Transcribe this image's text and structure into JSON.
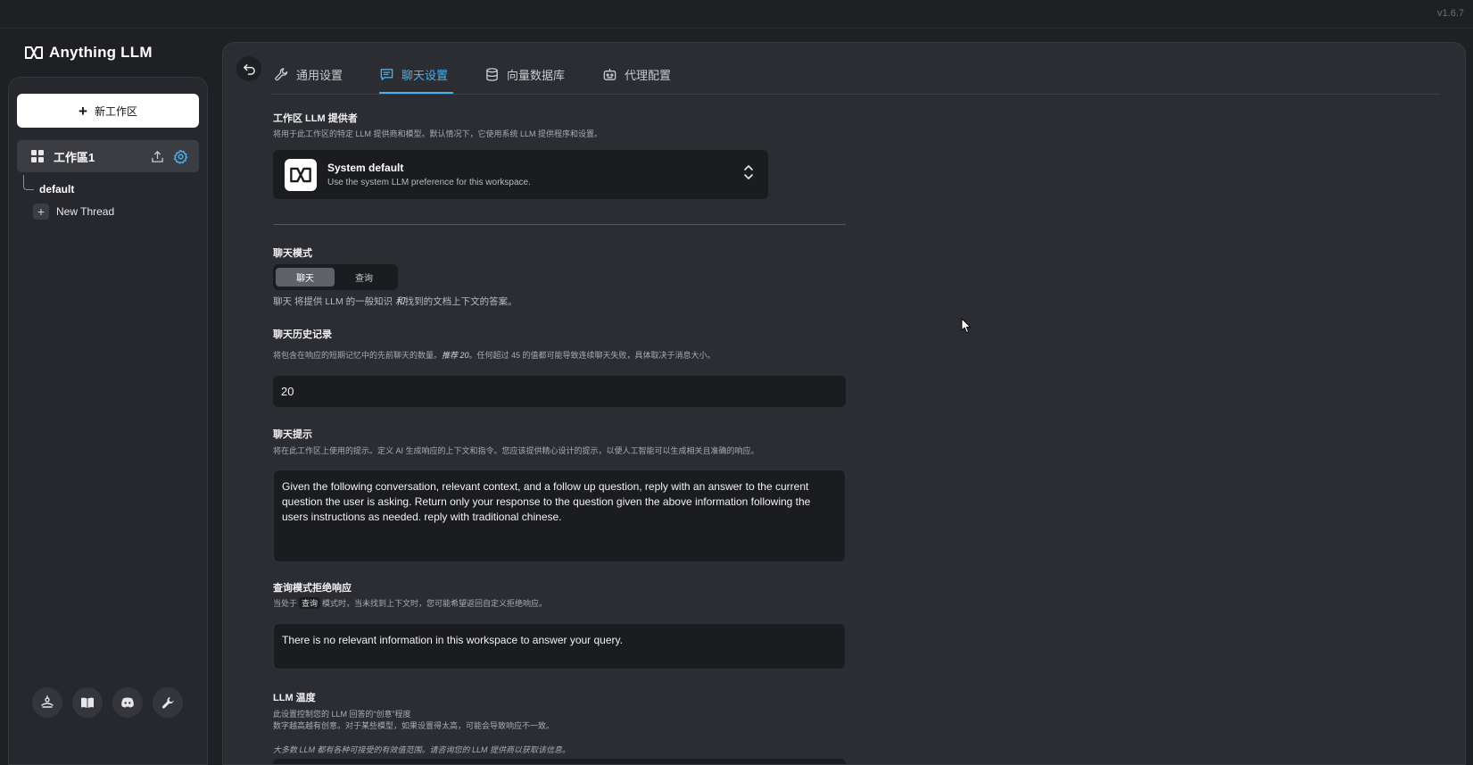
{
  "version": "v1.6.7",
  "app": {
    "name": "Anything LLM"
  },
  "sidebar": {
    "new_workspace_label": "新工作区",
    "workspace": {
      "name": "工作區1"
    },
    "thread_default": "default",
    "new_thread_label": "New Thread",
    "footer_icons": [
      "community-hub-icon",
      "docs-book-icon",
      "discord-icon",
      "settings-wrench-icon"
    ]
  },
  "tabs": [
    {
      "label": "通用设置",
      "icon": "wrench-icon",
      "active": false
    },
    {
      "label": "聊天设置",
      "icon": "chat-icon",
      "active": true
    },
    {
      "label": "向量数据库",
      "icon": "database-icon",
      "active": false
    },
    {
      "label": "代理配置",
      "icon": "robot-icon",
      "active": false
    }
  ],
  "llm_provider": {
    "title": "工作区 LLM 提供者",
    "desc": "将用于此工作区的特定 LLM 提供商和模型。默认情况下，它使用系统 LLM 提供程序和设置。",
    "selected_name": "System default",
    "selected_desc": "Use the system LLM preference for this workspace."
  },
  "chat_mode": {
    "title": "聊天模式",
    "options": [
      "聊天",
      "查询"
    ],
    "selected": "聊天",
    "desc_prefix": "聊天 将提供 LLM 的一般知识 ",
    "desc_emph": "和",
    "desc_suffix": "找到的文档上下文的答案。"
  },
  "chat_history": {
    "title": "聊天历史记录",
    "desc_prefix": "将包含在响应的短期记忆中的先前聊天的数量。",
    "desc_emph": "推荐 20",
    "desc_suffix": "。任何超过 45 的值都可能导致连续聊天失败，具体取决于消息大小。",
    "value": "20"
  },
  "chat_prompt": {
    "title": "聊天提示",
    "desc": "将在此工作区上使用的提示。定义 AI 生成响应的上下文和指令。您应该提供精心设计的提示，以便人工智能可以生成相关且准确的响应。",
    "value": "Given the following conversation, relevant context, and a follow up question, reply with an answer to the current question the user is asking. Return only your response to the question given the above information following the users instructions as needed. reply with traditional chinese."
  },
  "query_refusal": {
    "title": "查询模式拒绝响应",
    "desc_prefix": "当处于",
    "desc_code": "查询",
    "desc_suffix": "模式时，当未找到上下文时，您可能希望返回自定义拒绝响应。",
    "value": "There is no relevant information in this workspace to answer your query."
  },
  "llm_temperature": {
    "title": "LLM 温度",
    "desc_line1": "此设置控制您的 LLM 回答的“创意”程度",
    "desc_line2": "数字越高越有创意。对于某些模型，如果设置得太高，可能会导致响应不一致。",
    "desc_note": "大多数 LLM 都有各种可接受的有效值范围。请咨询您的 LLM 提供商以获取该信息。"
  }
}
